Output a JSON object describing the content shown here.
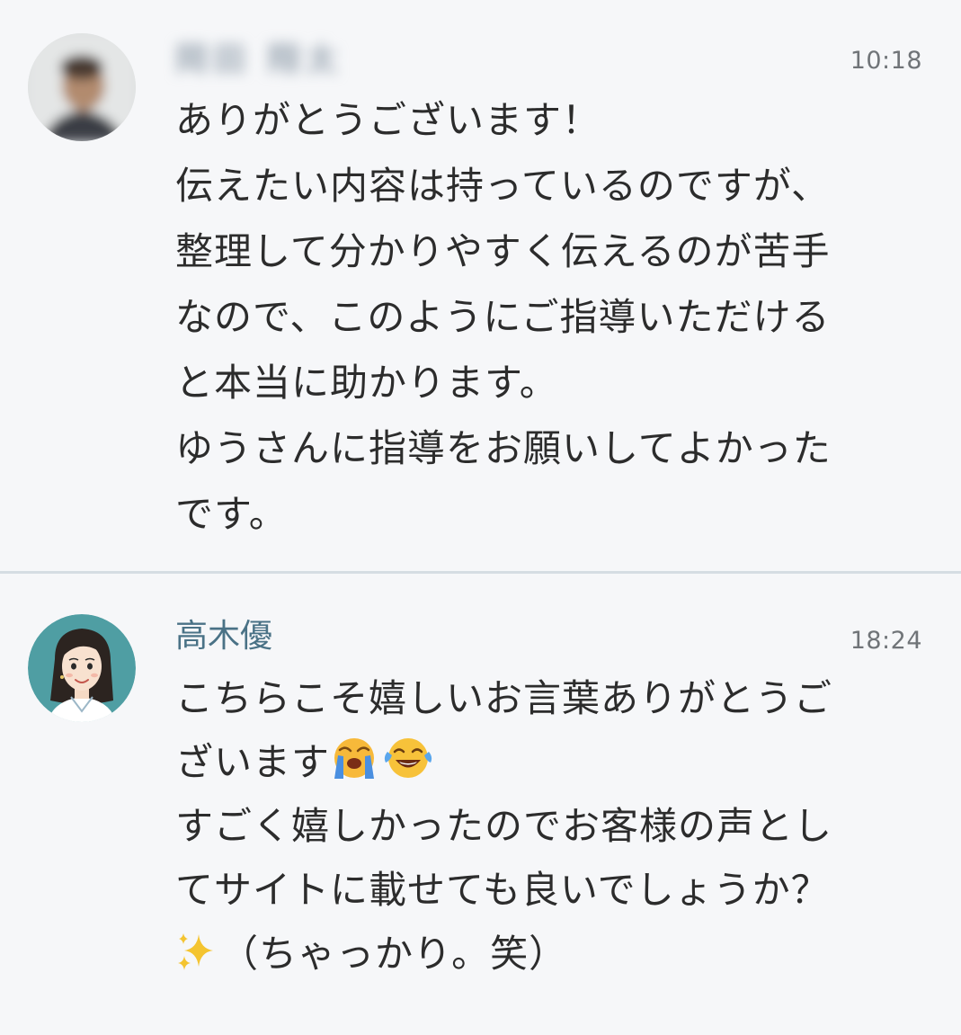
{
  "messages": [
    {
      "sender": "岡田 翔太",
      "time": "10:18",
      "lines": [
        "ありがとうございます！",
        "伝えたい内容は持っているのですが、",
        "整理して分かりやすく伝えるのが苦手",
        "なので、このようにご指導いただける",
        "と本当に助かります。",
        "ゆうさんに指導をお願いしてよかった",
        "です。"
      ]
    },
    {
      "sender": "高木優",
      "time": "18:24",
      "lines": [
        "こちらこそ嬉しいお言葉ありがとうご",
        "ざいます",
        "すごく嬉しかったのでお客様の声とし",
        "てサイトに載せても良いでしょうか？",
        "（ちゃっかり。笑）"
      ]
    }
  ],
  "emoji": {
    "crying": "loudly-crying-face",
    "laughing": "tears-of-joy-face",
    "sparkles": "sparkles"
  },
  "colors": {
    "background": "#f6f7f9",
    "divider": "#d5dde3",
    "sender_name": "#4a7286",
    "timestamp": "#707478",
    "text": "#2c2c2c",
    "avatar_ring": "#4f9ea3"
  }
}
